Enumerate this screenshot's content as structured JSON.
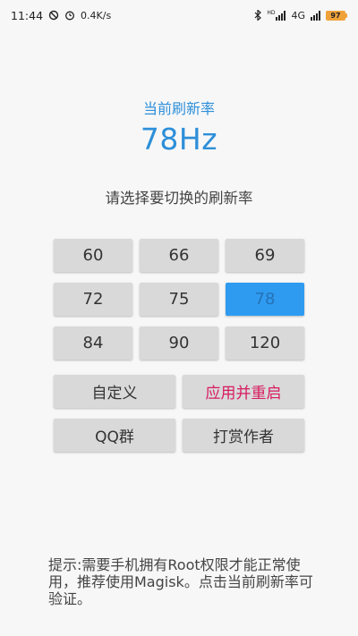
{
  "status_bar": {
    "time": "11:44",
    "net_speed": "0.4K/s",
    "hd_label": "HD",
    "network": "4G",
    "battery": "97"
  },
  "header": {
    "current_label": "当前刷新率",
    "current_value": "78Hz",
    "prompt": "请选择要切换的刷新率"
  },
  "rates": [
    "60",
    "66",
    "69",
    "72",
    "75",
    "78",
    "84",
    "90",
    "120"
  ],
  "selected_rate": "78",
  "actions": {
    "custom": "自定义",
    "apply_restart": "应用并重启",
    "qq_group": "QQ群",
    "donate": "打赏作者"
  },
  "tip": "提示:需要手机拥有Root权限才能正常使用，推荐使用Magisk。点击当前刷新率可验证。",
  "colors": {
    "accent": "#2d8fd9",
    "selected_button": "#2f9bf0",
    "danger_text": "#d81b60",
    "button_bg": "#d9d9d9"
  }
}
